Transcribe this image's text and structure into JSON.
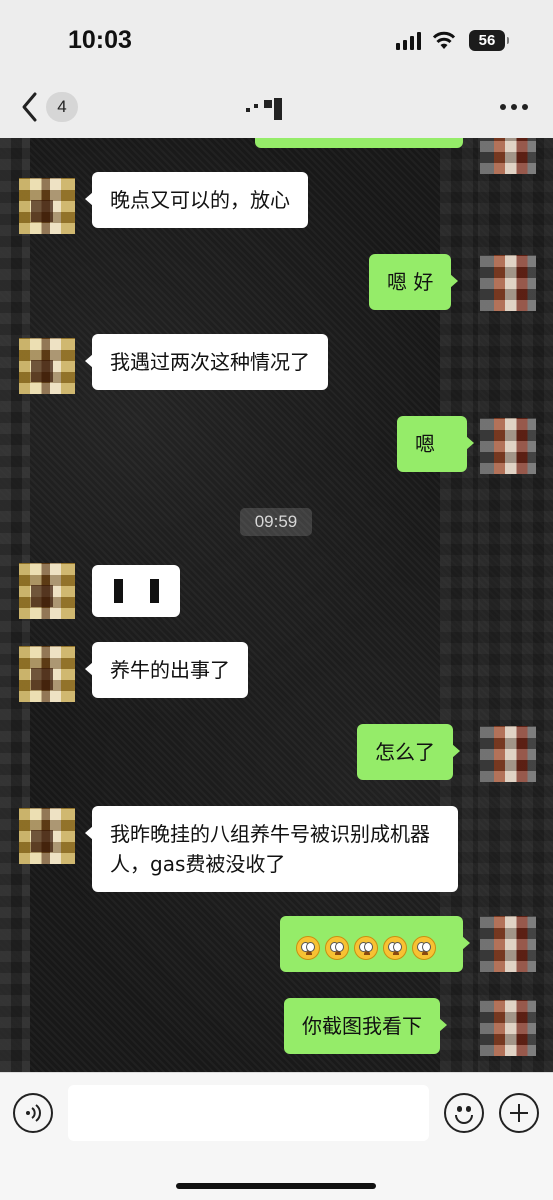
{
  "status_bar": {
    "time": "10:03",
    "battery": "56"
  },
  "header": {
    "unread_count": "4"
  },
  "messages": [
    {
      "side": "in",
      "text": "晚点又可以的，放心"
    },
    {
      "side": "out",
      "text": "嗯 好"
    },
    {
      "side": "in",
      "text": "我遇过两次这种情况了"
    },
    {
      "side": "out",
      "text": "嗯"
    },
    {
      "side": "in",
      "text": "养牛的出事了"
    },
    {
      "side": "out",
      "text": "怎么了"
    },
    {
      "side": "in",
      "text": "我昨晚挂的八组养牛号被识别成机器人，gas费被没收了"
    },
    {
      "side": "out",
      "emoji": "flushed-face",
      "count": 5
    },
    {
      "side": "out",
      "text": "你截图我看下"
    }
  ],
  "timestamp": "09:59",
  "input": {
    "placeholder": ""
  },
  "icons": {
    "back": "chevron-left-icon",
    "more": "more-dots-icon",
    "voice": "voice-icon",
    "emoji": "emoji-icon",
    "plus": "plus-icon"
  },
  "colors": {
    "outgoing_bubble": "#95ec69",
    "incoming_bubble": "#ffffff",
    "header_bg": "#ededed"
  }
}
